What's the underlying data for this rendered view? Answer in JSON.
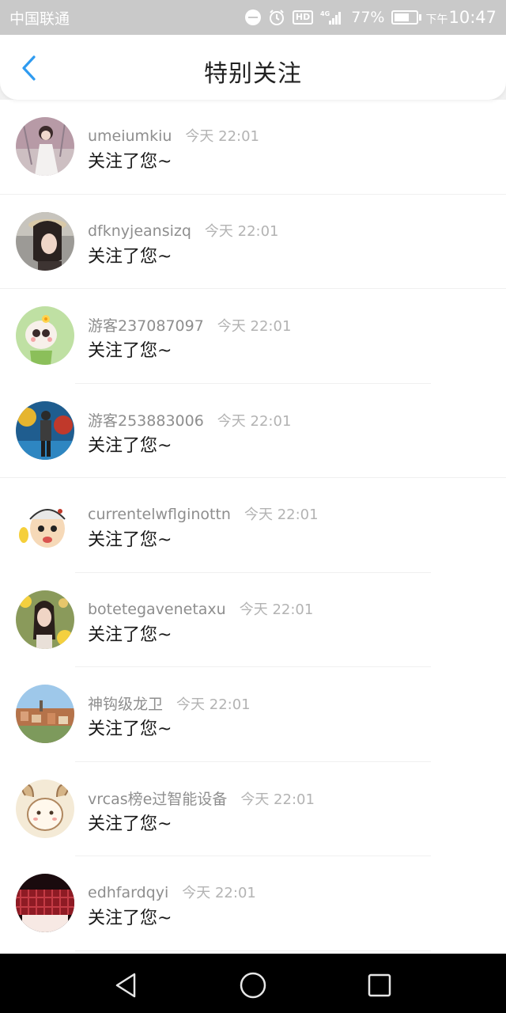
{
  "status_bar": {
    "carrier": "中国联通",
    "network": "4G",
    "hd": "HD",
    "battery": "77%",
    "time_ampm": "下午",
    "time": "10:47"
  },
  "header": {
    "title": "特别关注",
    "accent_color": "#2f9bf0"
  },
  "items": [
    {
      "username": "umeiumkiu",
      "time": "今天 22:01",
      "message": "关注了您~",
      "avatar": "photo-girl-white-dress"
    },
    {
      "username": "dfknyjeansizq",
      "time": "今天 22:01",
      "message": "关注了您~",
      "avatar": "photo-girl-hat"
    },
    {
      "username": "游客237087097",
      "time": "今天 22:01",
      "message": "关注了您~",
      "avatar": "cartoon-baby-flower"
    },
    {
      "username": "游客253883006",
      "time": "今天 22:01",
      "message": "关注了您~",
      "avatar": "photo-graffiti-wall"
    },
    {
      "username": "currentelwflginottn",
      "time": "今天 22:01",
      "message": "关注了您~",
      "avatar": "cartoon-old-man"
    },
    {
      "username": "botetegavenetaxu",
      "time": "今天 22:01",
      "message": "关注了您~",
      "avatar": "photo-girl-flowers"
    },
    {
      "username": "神钩级龙卫",
      "time": "今天 22:01",
      "message": "关注了您~",
      "avatar": "photo-city-view"
    },
    {
      "username": "vrcas榜e过智能设备",
      "time": "今天 22:01",
      "message": "关注了您~",
      "avatar": "cartoon-sheep"
    },
    {
      "username": "edhfardqyi",
      "time": "今天 22:01",
      "message": "关注了您~",
      "avatar": "photo-red-skirt"
    }
  ]
}
